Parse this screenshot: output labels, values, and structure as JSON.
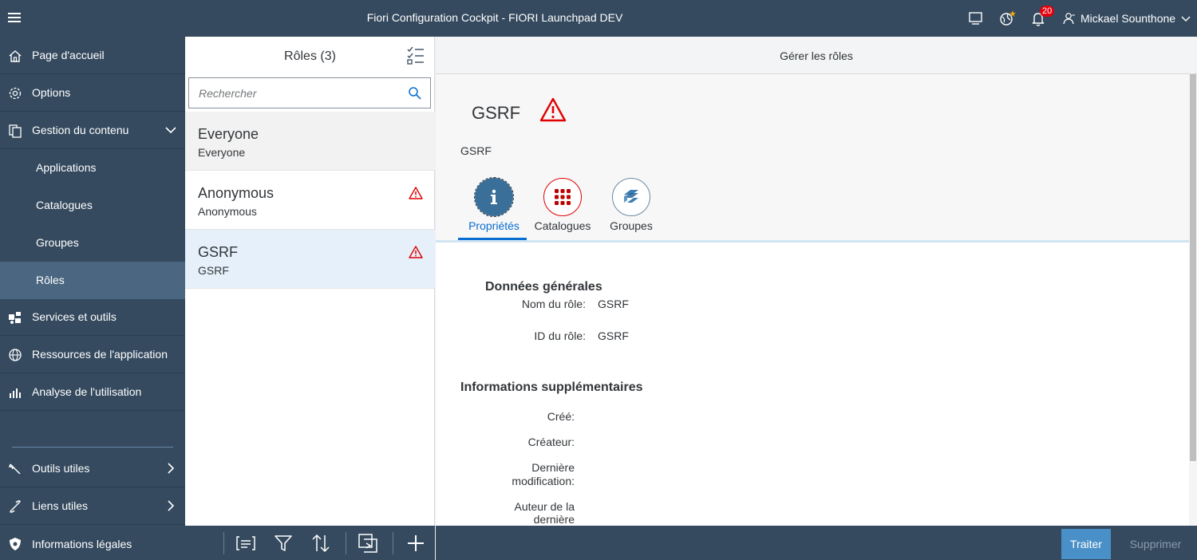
{
  "shell": {
    "title": "Fiori Configuration Cockpit - FIORI Launchpad DEV",
    "notification_count": "20",
    "user_name": "Mickael Sounthone"
  },
  "sidebar": {
    "items": [
      {
        "label": "Page d'accueil"
      },
      {
        "label": "Options"
      },
      {
        "label": "Gestion du contenu"
      },
      {
        "label": "Applications"
      },
      {
        "label": "Catalogues"
      },
      {
        "label": "Groupes"
      },
      {
        "label": "Rôles"
      },
      {
        "label": "Services et outils"
      },
      {
        "label": "Ressources de l'application"
      },
      {
        "label": "Analyse de l'utilisation"
      },
      {
        "label": "Outils utiles"
      },
      {
        "label": "Liens utiles"
      },
      {
        "label": "Informations légales"
      }
    ]
  },
  "master": {
    "title": "Rôles (3)",
    "search_placeholder": "Rechercher",
    "items": [
      {
        "title": "Everyone",
        "description": "Everyone"
      },
      {
        "title": "Anonymous",
        "description": "Anonymous"
      },
      {
        "title": "GSRF",
        "description": "GSRF"
      }
    ]
  },
  "detail": {
    "header_title": "Gérer les rôles",
    "object_title": "GSRF",
    "object_subtitle": "GSRF",
    "tabs": [
      {
        "label": "Propriétés"
      },
      {
        "label": "Catalogues"
      },
      {
        "label": "Groupes"
      }
    ],
    "general": {
      "title": "Données générales",
      "role_name_label": "Nom du rôle:",
      "role_name_value": "GSRF",
      "role_id_label": "ID du rôle:",
      "role_id_value": "GSRF"
    },
    "additional": {
      "title": "Informations supplémentaires",
      "created_label": "Créé:",
      "creator_label": "Créateur:",
      "last_modified_label_1": "Dernière",
      "last_modified_label_2": "modification:",
      "last_author_label_1": "Auteur de la",
      "last_author_label_2": "dernière"
    },
    "footer": {
      "edit_label": "Traiter",
      "delete_label": "Supprimer"
    }
  },
  "colors": {
    "shell": "#354a5f",
    "accent": "#0a6ed1",
    "warning": "#e00000",
    "primary_button": "#4a90c8"
  }
}
